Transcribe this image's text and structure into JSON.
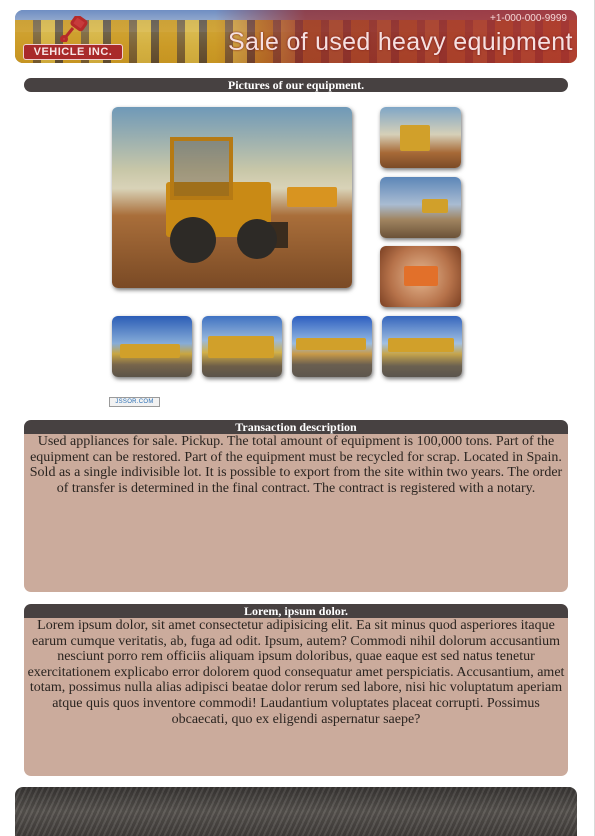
{
  "header": {
    "logo_text": "VEHICLE INC.",
    "phone": "+1-000-000-9999",
    "slogan": "Sale of used heavy equipment"
  },
  "gallery": {
    "heading": "Pictures of our equipment.",
    "slider_credit": "JSSOR.COM"
  },
  "transaction": {
    "heading": "Transaction description",
    "text": "Used appliances for sale. Pickup. The total amount of equipment is 100,000 tons. Part of the equipment can be restored. Part of the equipment must be recycled for scrap. Located in Spain. Sold as a single indivisible lot. It is possible to export from the site within two years. The order of transfer is determined in the final contract. The contract is registered with a notary."
  },
  "lorem": {
    "heading": "Lorem, ipsum dolor.",
    "text": "Lorem ipsum dolor, sit amet consectetur adipisicing elit. Ea sit minus quod asperiores itaque earum cumque veritatis, ab, fuga ad odit. Ipsum, autem? Commodi nihil dolorum accusantium nesciunt porro rem officiis aliquam ipsum doloribus, quae eaque est sed natus tenetur exercitationem explicabo error dolorem quod consequatur amet perspiciatis. Accusantium, amet totam, possimus nulla alias adipisci beatae dolor rerum sed labore, nisi hic voluptatum aperiam atque quis quos inventore commodi! Laudantium voluptates placeat corrupti. Possimus obcaecati, quo ex eligendi aspernatur saepe?"
  },
  "colors": {
    "heading_bar": "#474141",
    "text_box": "#cbab9c",
    "banner_accent": "#a92a2a"
  },
  "icons": {
    "logo": "piston-icon"
  }
}
